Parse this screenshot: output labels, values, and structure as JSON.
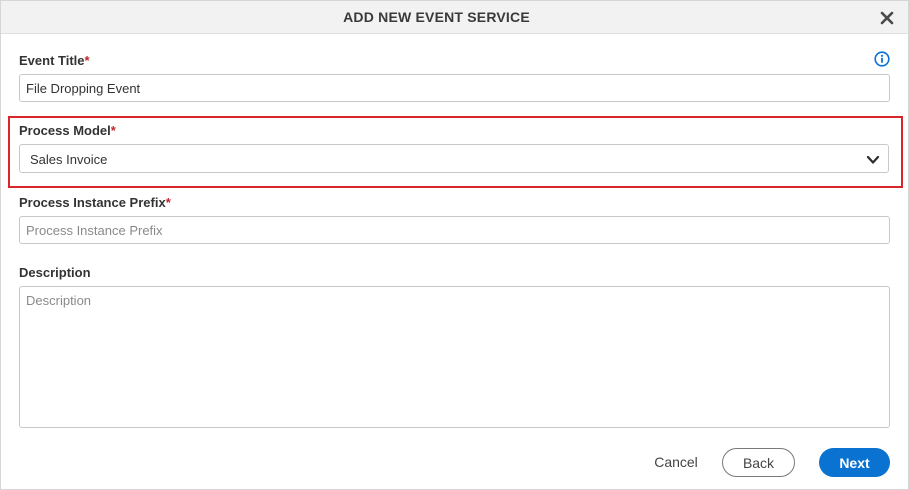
{
  "dialog": {
    "title": "ADD NEW EVENT SERVICE"
  },
  "colors": {
    "accent": "#0a72d1",
    "required": "#c0272d",
    "highlight": "#d9262c"
  },
  "icons": {
    "close": "close-icon",
    "info": "info-icon",
    "dropdown": "chevron-down-icon"
  },
  "form": {
    "required_marker": "*",
    "event_title": {
      "label": "Event Title",
      "value": "File Dropping Event"
    },
    "process_model": {
      "label": "Process Model",
      "selected": "Sales Invoice"
    },
    "process_instance_prefix": {
      "label": "Process Instance Prefix",
      "value": "",
      "placeholder": "Process Instance Prefix"
    },
    "description": {
      "label": "Description",
      "value": "",
      "placeholder": "Description"
    }
  },
  "footer": {
    "cancel_label": "Cancel",
    "back_label": "Back",
    "next_label": "Next"
  }
}
